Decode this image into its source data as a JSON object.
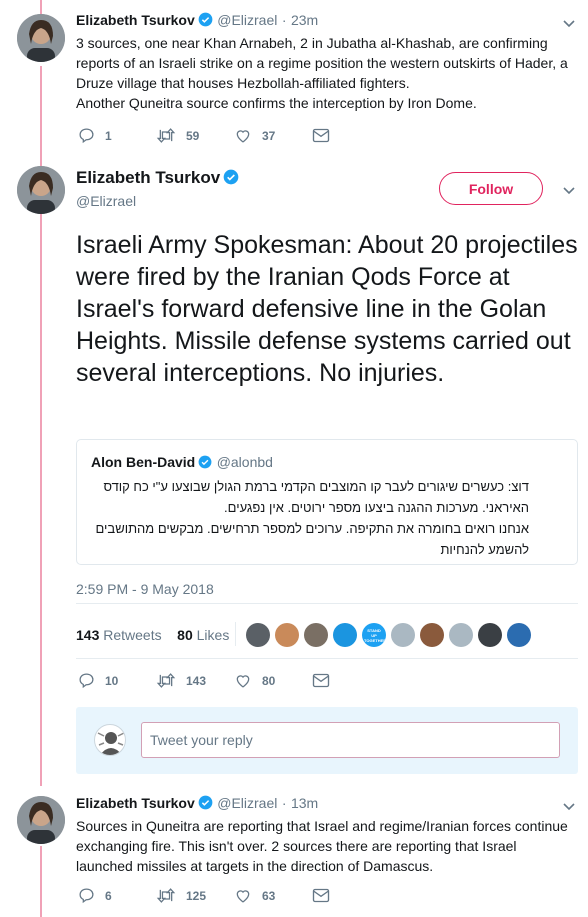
{
  "tweet1": {
    "name": "Elizabeth Tsurkov",
    "handle": "@Elizrael",
    "separator": "·",
    "time": "23m",
    "text": "3 sources, one near Khan Arnabeh, 2 in Jubatha al-Khashab, are confirming reports of an Israeli strike on a regime position the western outskirts of Hader, a Druze village that houses Hezbollah-affiliated fighters.\nAnother Quneitra source confirms the interception by Iron Dome.",
    "replies": "1",
    "retweets": "59",
    "likes": "37"
  },
  "tweet2": {
    "name": "Elizabeth Tsurkov",
    "handle": "@Elizrael",
    "follow_label": "Follow",
    "text": "Israeli Army Spokesman: About 20 projectiles were fired by the Iranian Qods Force at Israel's forward defensive line in the Golan Heights. Missile defense systems carried out several interceptions. No injuries.",
    "quote": {
      "name": "Alon Ben-David",
      "handle": "@alonbd",
      "text": "דוצ: כעשרים שיגורים לעבר קו המוצבים הקדמי ברמת הגולן שבוצעו ע\"י כח קודס האיראני. מערכות ההגנה ביצעו מספר ירוטים. אין נפגעים.\nאנחנו רואים בחומרה את התקיפה. ערוכים למספר תרחישים. מבקשים מהתושבים להשמע להנחיות"
    },
    "timestamp": "2:59 PM - 9 May 2018",
    "retweets_count": "143",
    "retweets_label": "Retweets",
    "likes_count": "80",
    "likes_label": "Likes",
    "replies": "10",
    "retweets": "143",
    "likes": "80",
    "reply_placeholder": "Tweet your reply",
    "liker_avatar_colors": [
      "#5a6066",
      "#c98a5a",
      "#7a6f64",
      "#1b95e0",
      "#1da1f2",
      "#aab8c2",
      "#8a5a3c",
      "#aab8c2",
      "#3a3f44",
      "#2b6cb0"
    ],
    "liker_badge_text": "STAND UP TOGETHER"
  },
  "tweet3": {
    "name": "Elizabeth Tsurkov",
    "handle": "@Elizrael",
    "separator": "·",
    "time": "13m",
    "text": "Sources in Quneitra are reporting that Israel and regime/Iranian forces continue exchanging fire. This isn't over. 2 sources there are reporting that Israel launched missiles at targets in the direction of Damascus.",
    "replies": "6",
    "retweets": "125",
    "likes": "63"
  },
  "colors": {
    "thread_line": "#f0a1b7",
    "follow": "#e0245e",
    "link_blue": "#1da1f2",
    "muted": "#657786"
  }
}
